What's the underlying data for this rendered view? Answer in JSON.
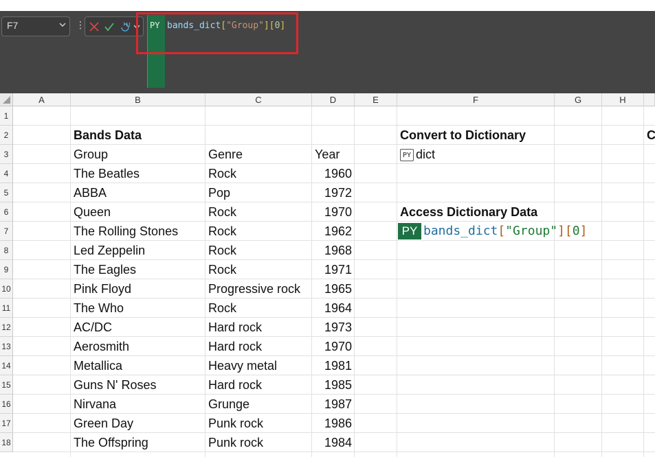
{
  "formula_bar": {
    "name_box": "F7",
    "py_label": "PY",
    "formula": {
      "ident": "bands_dict",
      "open1": "[",
      "str": "\"Group\"",
      "close1": "]",
      "open2": "[",
      "num": "0",
      "close2": "]"
    }
  },
  "columns": [
    "A",
    "B",
    "C",
    "D",
    "E",
    "F",
    "G",
    "H"
  ],
  "rows": [
    "1",
    "2",
    "3",
    "4",
    "5",
    "6",
    "7",
    "8",
    "9",
    "10",
    "11",
    "12",
    "13",
    "14",
    "15",
    "16",
    "17",
    "18"
  ],
  "bands": {
    "title": "Bands Data",
    "headers": {
      "group": "Group",
      "genre": "Genre",
      "year": "Year"
    },
    "rows": [
      {
        "group": "The Beatles",
        "genre": "Rock",
        "year": "1960"
      },
      {
        "group": "ABBA",
        "genre": "Pop",
        "year": "1972"
      },
      {
        "group": "Queen",
        "genre": "Rock",
        "year": "1970"
      },
      {
        "group": "The Rolling Stones",
        "genre": "Rock",
        "year": "1962"
      },
      {
        "group": "Led Zeppelin",
        "genre": "Rock",
        "year": "1968"
      },
      {
        "group": "The Eagles",
        "genre": "Rock",
        "year": "1971"
      },
      {
        "group": "Pink Floyd",
        "genre": "Progressive rock",
        "year": "1965"
      },
      {
        "group": "The Who",
        "genre": "Rock",
        "year": "1964"
      },
      {
        "group": "AC/DC",
        "genre": "Hard rock",
        "year": "1973"
      },
      {
        "group": "Aerosmith",
        "genre": "Hard rock",
        "year": "1970"
      },
      {
        "group": "Metallica",
        "genre": "Heavy metal",
        "year": "1981"
      },
      {
        "group": "Guns N' Roses",
        "genre": "Hard rock",
        "year": "1985"
      },
      {
        "group": "Nirvana",
        "genre": "Grunge",
        "year": "1987"
      },
      {
        "group": "Green Day",
        "genre": "Punk rock",
        "year": "1986"
      },
      {
        "group": "The Offspring",
        "genre": "Punk rock",
        "year": "1984"
      }
    ]
  },
  "convert": {
    "title": "Convert to Dictionary",
    "badge": "PY",
    "value": "dict"
  },
  "access": {
    "title": "Access Dictionary Data",
    "py_label": "PY"
  },
  "partial_i2": "C",
  "colors": {
    "python_green": "#1e7145",
    "highlight_red": "#e0262b"
  }
}
